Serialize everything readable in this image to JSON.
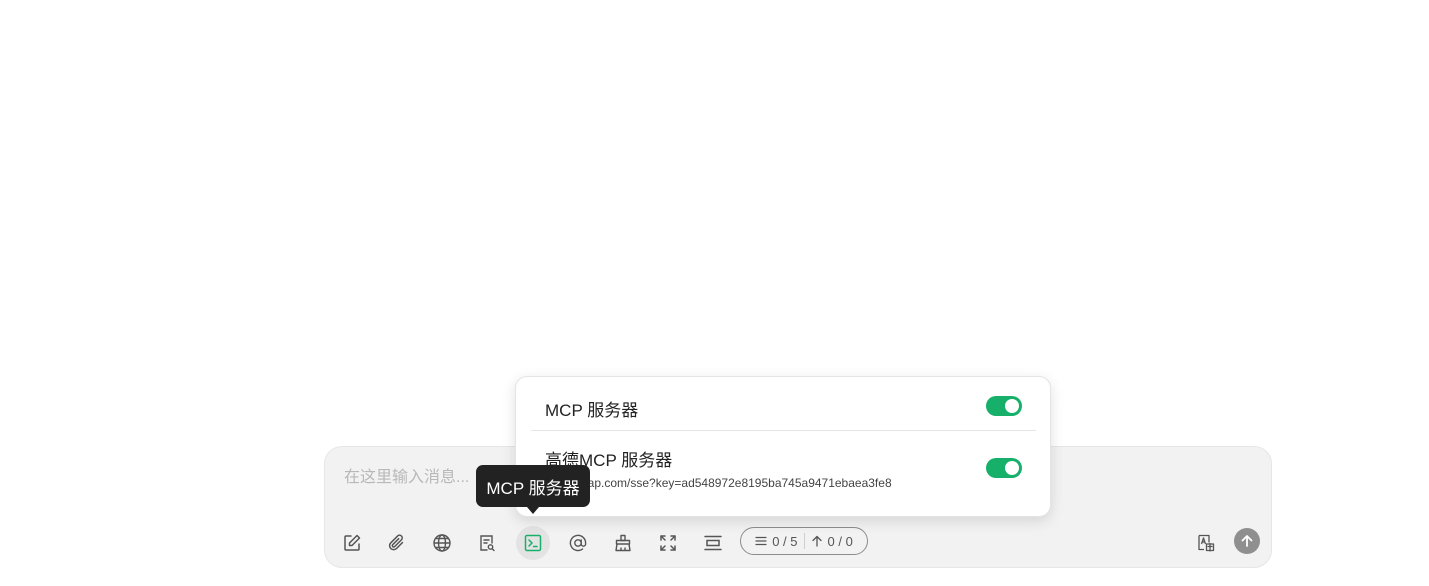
{
  "input": {
    "placeholder": "在这里输入消息..."
  },
  "toolbar": {
    "buttons": [
      {
        "icon": "edit-icon"
      },
      {
        "icon": "attachment-icon"
      },
      {
        "icon": "globe-icon"
      },
      {
        "icon": "knowledge-search-icon"
      },
      {
        "icon": "terminal-icon",
        "active": true
      },
      {
        "icon": "at-mention-icon"
      },
      {
        "icon": "clear-brush-icon"
      },
      {
        "icon": "expand-icon"
      },
      {
        "icon": "layout-icon"
      }
    ],
    "context_count": "0 / 5",
    "token_count": "0 / 0",
    "translate_icon": "translate-icon",
    "send_icon": "arrow-up-icon"
  },
  "mcp_panel": {
    "title": "MCP 服务器",
    "enabled": true,
    "servers": [
      {
        "name": "高德MCP 服务器",
        "url": "https://mcp.amap.com/sse?key=ad548972e8195ba745a9471ebaea3fe8",
        "url_visible": "mcp.amap.com/sse?key=ad548972e8195ba745a9471ebaea3fe8",
        "enabled": true
      }
    ]
  },
  "tooltip": {
    "text": "MCP 服务器"
  },
  "colors": {
    "accent": "#16b06a",
    "tooltip_bg": "#222222",
    "input_bg": "#f2f2f2"
  }
}
